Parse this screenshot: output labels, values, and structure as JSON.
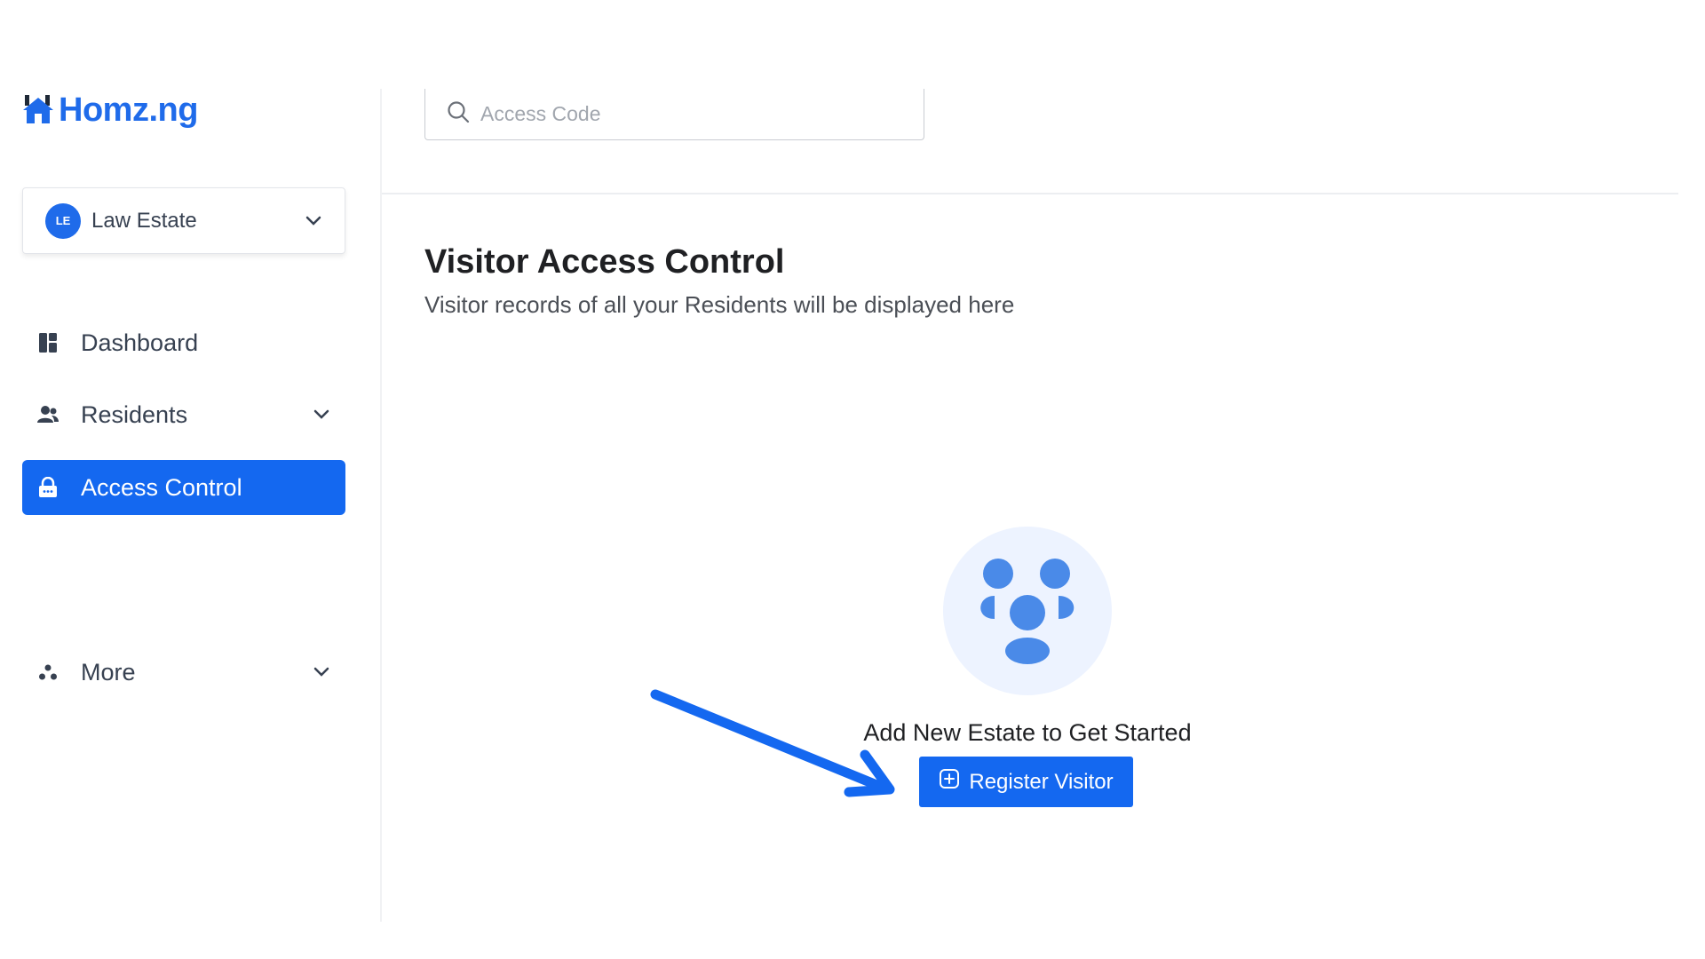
{
  "brand": {
    "name": "Homz.ng",
    "accent": "#1468f0"
  },
  "estate_selector": {
    "initials": "LE",
    "name": "Law Estate"
  },
  "sidebar": {
    "items": [
      {
        "label": "Dashboard",
        "icon": "dashboard-icon",
        "has_chevron": false,
        "active": false
      },
      {
        "label": "Residents",
        "icon": "residents-icon",
        "has_chevron": true,
        "active": false
      },
      {
        "label": "Access Control",
        "icon": "lock-icon",
        "has_chevron": false,
        "active": true
      },
      {
        "label": "More",
        "icon": "more-icon",
        "has_chevron": true,
        "active": false
      }
    ]
  },
  "search": {
    "placeholder": "Access Code",
    "value": ""
  },
  "page": {
    "title": "Visitor Access Control",
    "subtitle": "Visitor records of all your Residents will be displayed here"
  },
  "empty_state": {
    "message": "Add New Estate to Get Started",
    "button_label": "Register Visitor"
  }
}
